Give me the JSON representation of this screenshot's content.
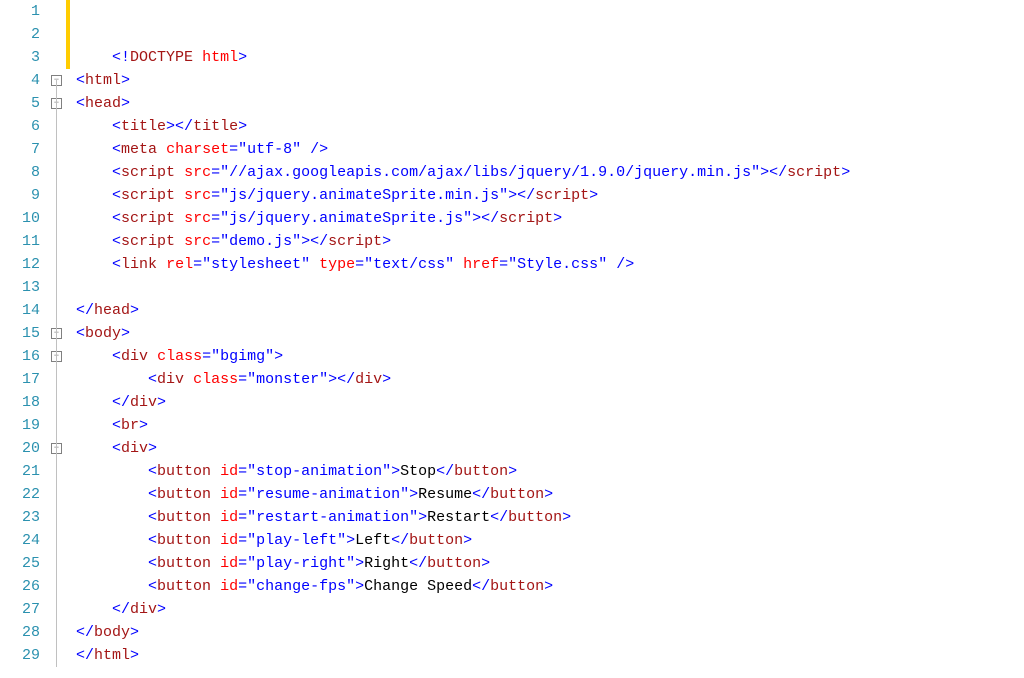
{
  "editor": {
    "line_count": 29,
    "highlighted_lines": [
      1,
      2,
      3
    ],
    "fold_markers": [
      {
        "line": 4,
        "state": "expanded"
      },
      {
        "line": 5,
        "state": "expanded"
      },
      {
        "line": 15,
        "state": "expanded"
      },
      {
        "line": 16,
        "state": "expanded"
      },
      {
        "line": 20,
        "state": "expanded"
      }
    ],
    "lines": {
      "1": {
        "ind": 0,
        "tokens": []
      },
      "2": {
        "ind": 0,
        "tokens": []
      },
      "3": {
        "ind": 1,
        "tokens": [
          {
            "c": "blue",
            "t": "<!"
          },
          {
            "c": "maroon",
            "t": "DOCTYPE"
          },
          {
            "c": "text",
            "t": " "
          },
          {
            "c": "red",
            "t": "html"
          },
          {
            "c": "blue",
            "t": ">"
          }
        ]
      },
      "4": {
        "ind": 0,
        "tokens": [
          {
            "c": "blue",
            "t": "<"
          },
          {
            "c": "maroon",
            "t": "html"
          },
          {
            "c": "blue",
            "t": ">"
          }
        ]
      },
      "5": {
        "ind": 0,
        "tokens": [
          {
            "c": "blue",
            "t": "<"
          },
          {
            "c": "maroon",
            "t": "head"
          },
          {
            "c": "blue",
            "t": ">"
          }
        ]
      },
      "6": {
        "ind": 1,
        "tokens": [
          {
            "c": "blue",
            "t": "<"
          },
          {
            "c": "maroon",
            "t": "title"
          },
          {
            "c": "blue",
            "t": "></"
          },
          {
            "c": "maroon",
            "t": "title"
          },
          {
            "c": "blue",
            "t": ">"
          }
        ]
      },
      "7": {
        "ind": 1,
        "tokens": [
          {
            "c": "blue",
            "t": "<"
          },
          {
            "c": "maroon",
            "t": "meta"
          },
          {
            "c": "text",
            "t": " "
          },
          {
            "c": "red",
            "t": "charset"
          },
          {
            "c": "blue",
            "t": "=\"utf-8\" />"
          }
        ]
      },
      "8": {
        "ind": 1,
        "tokens": [
          {
            "c": "blue",
            "t": "<"
          },
          {
            "c": "maroon",
            "t": "script"
          },
          {
            "c": "text",
            "t": " "
          },
          {
            "c": "red",
            "t": "src"
          },
          {
            "c": "blue",
            "t": "=\"//ajax.googleapis.com/ajax/libs/jquery/1.9.0/jquery.min.js\"></"
          },
          {
            "c": "maroon",
            "t": "script"
          },
          {
            "c": "blue",
            "t": ">"
          }
        ]
      },
      "9": {
        "ind": 1,
        "tokens": [
          {
            "c": "blue",
            "t": "<"
          },
          {
            "c": "maroon",
            "t": "script"
          },
          {
            "c": "text",
            "t": " "
          },
          {
            "c": "red",
            "t": "src"
          },
          {
            "c": "blue",
            "t": "=\"js/jquery.animateSprite.min.js\"></"
          },
          {
            "c": "maroon",
            "t": "script"
          },
          {
            "c": "blue",
            "t": ">"
          }
        ]
      },
      "10": {
        "ind": 1,
        "tokens": [
          {
            "c": "blue",
            "t": "<"
          },
          {
            "c": "maroon",
            "t": "script"
          },
          {
            "c": "text",
            "t": " "
          },
          {
            "c": "red",
            "t": "src"
          },
          {
            "c": "blue",
            "t": "=\"js/jquery.animateSprite.js\"></"
          },
          {
            "c": "maroon",
            "t": "script"
          },
          {
            "c": "blue",
            "t": ">"
          }
        ]
      },
      "11": {
        "ind": 1,
        "tokens": [
          {
            "c": "blue",
            "t": "<"
          },
          {
            "c": "maroon",
            "t": "script"
          },
          {
            "c": "text",
            "t": " "
          },
          {
            "c": "red",
            "t": "src"
          },
          {
            "c": "blue",
            "t": "=\"demo.js\"></"
          },
          {
            "c": "maroon",
            "t": "script"
          },
          {
            "c": "blue",
            "t": ">"
          }
        ]
      },
      "12": {
        "ind": 1,
        "tokens": [
          {
            "c": "blue",
            "t": "<"
          },
          {
            "c": "maroon",
            "t": "link"
          },
          {
            "c": "text",
            "t": " "
          },
          {
            "c": "red",
            "t": "rel"
          },
          {
            "c": "blue",
            "t": "=\"stylesheet\" "
          },
          {
            "c": "red",
            "t": "type"
          },
          {
            "c": "blue",
            "t": "=\"text/css\" "
          },
          {
            "c": "red",
            "t": "href"
          },
          {
            "c": "blue",
            "t": "=\"Style.css\" />"
          }
        ]
      },
      "13": {
        "ind": 0,
        "tokens": []
      },
      "14": {
        "ind": 0,
        "tokens": [
          {
            "c": "blue",
            "t": "</"
          },
          {
            "c": "maroon",
            "t": "head"
          },
          {
            "c": "blue",
            "t": ">"
          }
        ]
      },
      "15": {
        "ind": 0,
        "tokens": [
          {
            "c": "blue",
            "t": "<"
          },
          {
            "c": "maroon",
            "t": "body"
          },
          {
            "c": "blue",
            "t": ">"
          }
        ]
      },
      "16": {
        "ind": 1,
        "tokens": [
          {
            "c": "blue",
            "t": "<"
          },
          {
            "c": "maroon",
            "t": "div"
          },
          {
            "c": "text",
            "t": " "
          },
          {
            "c": "red",
            "t": "class"
          },
          {
            "c": "blue",
            "t": "=\"bgimg\">"
          }
        ]
      },
      "17": {
        "ind": 2,
        "tokens": [
          {
            "c": "blue",
            "t": "<"
          },
          {
            "c": "maroon",
            "t": "div"
          },
          {
            "c": "text",
            "t": " "
          },
          {
            "c": "red",
            "t": "class"
          },
          {
            "c": "blue",
            "t": "=\"monster\"></"
          },
          {
            "c": "maroon",
            "t": "div"
          },
          {
            "c": "blue",
            "t": ">"
          }
        ]
      },
      "18": {
        "ind": 1,
        "tokens": [
          {
            "c": "blue",
            "t": "</"
          },
          {
            "c": "maroon",
            "t": "div"
          },
          {
            "c": "blue",
            "t": ">"
          }
        ]
      },
      "19": {
        "ind": 1,
        "tokens": [
          {
            "c": "blue",
            "t": "<"
          },
          {
            "c": "maroon",
            "t": "br"
          },
          {
            "c": "blue",
            "t": ">"
          }
        ]
      },
      "20": {
        "ind": 1,
        "tokens": [
          {
            "c": "blue",
            "t": "<"
          },
          {
            "c": "maroon",
            "t": "div"
          },
          {
            "c": "blue",
            "t": ">"
          }
        ]
      },
      "21": {
        "ind": 2,
        "tokens": [
          {
            "c": "blue",
            "t": "<"
          },
          {
            "c": "maroon",
            "t": "button"
          },
          {
            "c": "text",
            "t": " "
          },
          {
            "c": "red",
            "t": "id"
          },
          {
            "c": "blue",
            "t": "=\"stop-animation\">"
          },
          {
            "c": "text",
            "t": "Stop"
          },
          {
            "c": "blue",
            "t": "</"
          },
          {
            "c": "maroon",
            "t": "button"
          },
          {
            "c": "blue",
            "t": ">"
          }
        ]
      },
      "22": {
        "ind": 2,
        "tokens": [
          {
            "c": "blue",
            "t": "<"
          },
          {
            "c": "maroon",
            "t": "button"
          },
          {
            "c": "text",
            "t": " "
          },
          {
            "c": "red",
            "t": "id"
          },
          {
            "c": "blue",
            "t": "=\"resume-animation\">"
          },
          {
            "c": "text",
            "t": "Resume"
          },
          {
            "c": "blue",
            "t": "</"
          },
          {
            "c": "maroon",
            "t": "button"
          },
          {
            "c": "blue",
            "t": ">"
          }
        ]
      },
      "23": {
        "ind": 2,
        "tokens": [
          {
            "c": "blue",
            "t": "<"
          },
          {
            "c": "maroon",
            "t": "button"
          },
          {
            "c": "text",
            "t": " "
          },
          {
            "c": "red",
            "t": "id"
          },
          {
            "c": "blue",
            "t": "=\"restart-animation\">"
          },
          {
            "c": "text",
            "t": "Restart"
          },
          {
            "c": "blue",
            "t": "</"
          },
          {
            "c": "maroon",
            "t": "button"
          },
          {
            "c": "blue",
            "t": ">"
          }
        ]
      },
      "24": {
        "ind": 2,
        "tokens": [
          {
            "c": "blue",
            "t": "<"
          },
          {
            "c": "maroon",
            "t": "button"
          },
          {
            "c": "text",
            "t": " "
          },
          {
            "c": "red",
            "t": "id"
          },
          {
            "c": "blue",
            "t": "=\"play-left\">"
          },
          {
            "c": "text",
            "t": "Left"
          },
          {
            "c": "blue",
            "t": "</"
          },
          {
            "c": "maroon",
            "t": "button"
          },
          {
            "c": "blue",
            "t": ">"
          }
        ]
      },
      "25": {
        "ind": 2,
        "tokens": [
          {
            "c": "blue",
            "t": "<"
          },
          {
            "c": "maroon",
            "t": "button"
          },
          {
            "c": "text",
            "t": " "
          },
          {
            "c": "red",
            "t": "id"
          },
          {
            "c": "blue",
            "t": "=\"play-right\">"
          },
          {
            "c": "text",
            "t": "Right"
          },
          {
            "c": "blue",
            "t": "</"
          },
          {
            "c": "maroon",
            "t": "button"
          },
          {
            "c": "blue",
            "t": ">"
          }
        ]
      },
      "26": {
        "ind": 2,
        "tokens": [
          {
            "c": "blue",
            "t": "<"
          },
          {
            "c": "maroon",
            "t": "button"
          },
          {
            "c": "text",
            "t": " "
          },
          {
            "c": "red",
            "t": "id"
          },
          {
            "c": "blue",
            "t": "=\"change-fps\">"
          },
          {
            "c": "text",
            "t": "Change Speed"
          },
          {
            "c": "blue",
            "t": "</"
          },
          {
            "c": "maroon",
            "t": "button"
          },
          {
            "c": "blue",
            "t": ">"
          }
        ]
      },
      "27": {
        "ind": 1,
        "tokens": [
          {
            "c": "blue",
            "t": "</"
          },
          {
            "c": "maroon",
            "t": "div"
          },
          {
            "c": "blue",
            "t": ">"
          }
        ]
      },
      "28": {
        "ind": 0,
        "tokens": [
          {
            "c": "blue",
            "t": "</"
          },
          {
            "c": "maroon",
            "t": "body"
          },
          {
            "c": "blue",
            "t": ">"
          }
        ]
      },
      "29": {
        "ind": 0,
        "tokens": [
          {
            "c": "blue",
            "t": "</"
          },
          {
            "c": "maroon",
            "t": "html"
          },
          {
            "c": "blue",
            "t": ">"
          }
        ]
      }
    }
  }
}
